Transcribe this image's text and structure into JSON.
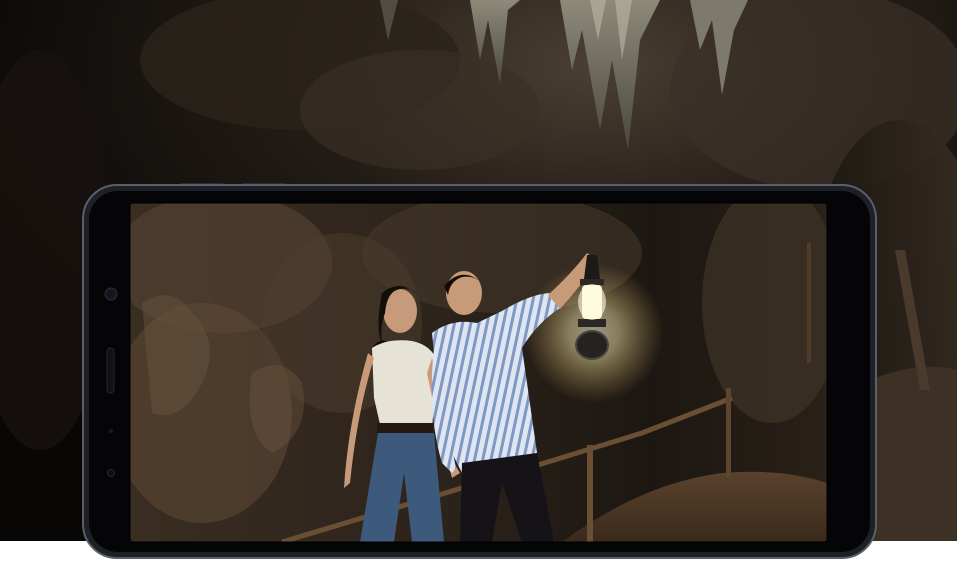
{
  "scene": {
    "background_colors": {
      "cave_dark": "#0b0908",
      "cave_mid": "#2a221b",
      "stalactite": "#6f6a5e",
      "stalactite_light": "#a9a692"
    },
    "phone": {
      "frame_color": "#14161b",
      "bezel_color": "#050507",
      "edge_highlight": "#5a5f6a"
    },
    "screen_photo": {
      "people": [
        "woman",
        "man-with-lantern"
      ],
      "lantern_glow": "#fff3c4",
      "shirt_stripes": "#9fb4d6"
    }
  }
}
